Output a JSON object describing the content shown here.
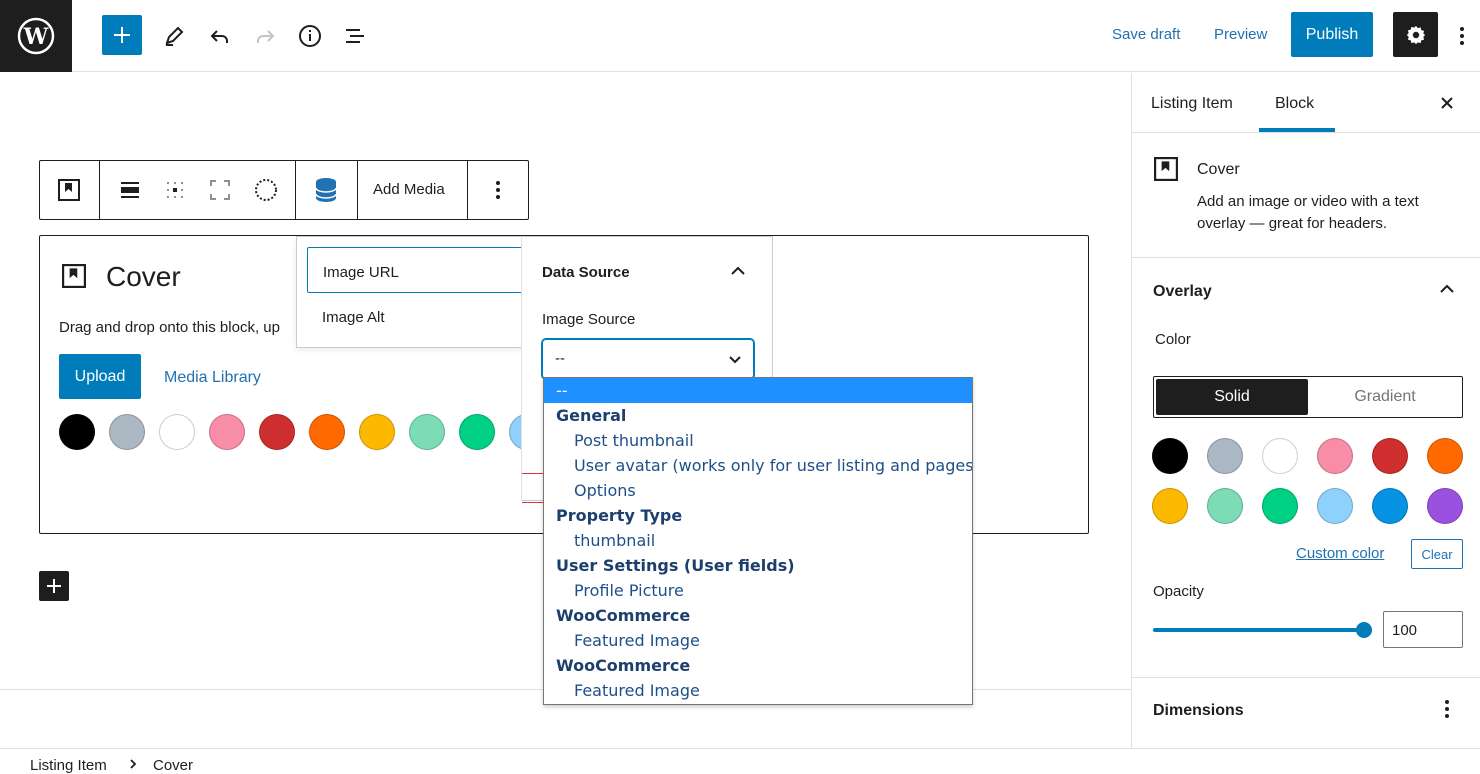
{
  "header": {
    "save_draft": "Save draft",
    "preview": "Preview",
    "publish": "Publish"
  },
  "block_toolbar": {
    "add_media": "Add Media"
  },
  "cover": {
    "title": "Cover",
    "instructions": "Drag and drop onto this block, up",
    "upload": "Upload",
    "media_library": "Media Library",
    "swatches": [
      "#000000",
      "#abb8c3",
      "#ffffff",
      "#f78da7",
      "#cf2e2e",
      "#ff6900",
      "#fcb900",
      "#7bdcb5",
      "#00d084",
      "#8ed1fc"
    ]
  },
  "binding_fields": {
    "items": [
      {
        "label": "Image URL",
        "selected": true
      },
      {
        "label": "Image Alt",
        "selected": false
      }
    ]
  },
  "data_source": {
    "title": "Data Source",
    "image_source_label": "Image Source",
    "selected_value": "--"
  },
  "dropdown": {
    "options": [
      {
        "type": "option",
        "label": "--",
        "highlighted": true
      },
      {
        "type": "group",
        "label": "General"
      },
      {
        "type": "option",
        "label": "Post thumbnail"
      },
      {
        "type": "option",
        "label": "User avatar (works only for user listing and pages)"
      },
      {
        "type": "option",
        "label": "Options"
      },
      {
        "type": "group",
        "label": "Property Type"
      },
      {
        "type": "option",
        "label": "thumbnail"
      },
      {
        "type": "group",
        "label": "User Settings (User fields)"
      },
      {
        "type": "option",
        "label": "Profile Picture"
      },
      {
        "type": "group",
        "label": "WooCommerce"
      },
      {
        "type": "option",
        "label": "Featured Image"
      },
      {
        "type": "group",
        "label": "WooCommerce"
      },
      {
        "type": "option",
        "label": "Featured Image"
      }
    ]
  },
  "sidebar": {
    "tabs": [
      "Listing Item",
      "Block"
    ],
    "active_tab": "Block",
    "block_name": "Cover",
    "block_desc": "Add an image or video with a text overlay — great for headers.",
    "overlay_title": "Overlay",
    "color_label": "Color",
    "solid": "Solid",
    "gradient": "Gradient",
    "swatches": [
      "#000000",
      "#abb8c3",
      "#ffffff",
      "#f78da7",
      "#cf2e2e",
      "#ff6900",
      "#fcb900",
      "#7bdcb5",
      "#00d084",
      "#8ed1fc",
      "#0693e3",
      "#9b51e0"
    ],
    "custom_color": "Custom color",
    "clear": "Clear",
    "opacity_label": "Opacity",
    "opacity_value": "100",
    "dimensions_title": "Dimensions"
  },
  "breadcrumb": [
    "Listing Item",
    "Cover"
  ],
  "colors": {
    "accent": "#007cba",
    "dark": "#1e1e1e",
    "highlight": "#1e90ff"
  }
}
